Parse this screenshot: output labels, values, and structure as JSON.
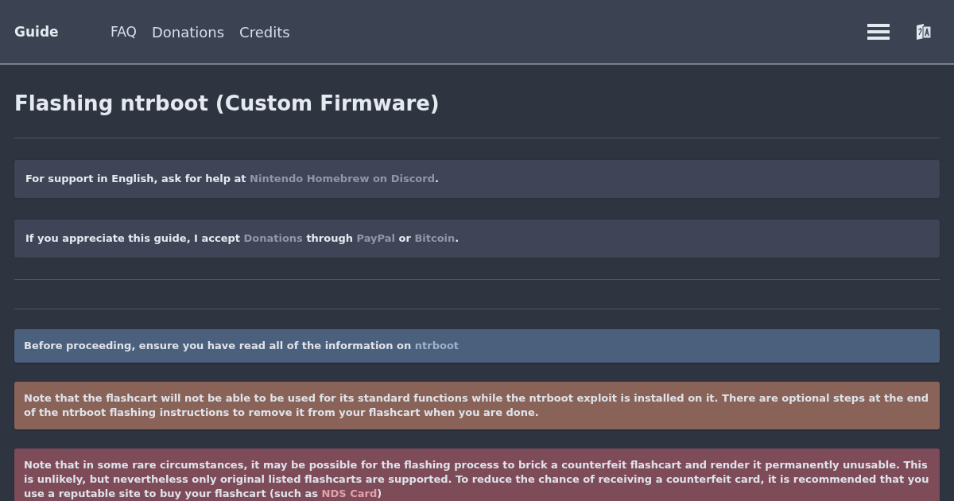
{
  "header": {
    "brand": "Guide",
    "nav": [
      {
        "label": "FAQ"
      },
      {
        "label": "Donations"
      },
      {
        "label": "Credits"
      }
    ]
  },
  "title": "Flashing ntrboot (Custom Firmware)",
  "notices": [
    {
      "segments": [
        {
          "text": "For support in English, ask for help at "
        },
        {
          "link": "Nintendo Homebrew on Discord"
        },
        {
          "text": "."
        }
      ]
    },
    {
      "segments": [
        {
          "text": "If you appreciate this guide, I accept "
        },
        {
          "link": "Donations"
        },
        {
          "text": " through "
        },
        {
          "link": "PayPal"
        },
        {
          "text": " or "
        },
        {
          "link": "Bitcoin"
        },
        {
          "text": "."
        }
      ]
    }
  ],
  "callouts": [
    {
      "kind": "info",
      "segments": [
        {
          "text": "Before proceeding, ensure you have read all of the information on "
        },
        {
          "link": "ntrboot"
        }
      ]
    },
    {
      "kind": "warning",
      "segments": [
        {
          "text": "Note that the flashcart will not be able to be used for its standard functions while the ntrboot exploit is installed on it. There are optional steps at the end of the ntrboot flashing instructions to remove it from your flashcart when you are done."
        }
      ]
    },
    {
      "kind": "danger",
      "segments": [
        {
          "text": "Note that in some rare circumstances, it may be possible for the flashing process to brick a counterfeit flashcart and render it permanently unusable. This is unlikely, but nevertheless only original listed flashcarts are supported. To reduce the chance of receiving a counterfeit card, it is recommended that you use a reputable site to buy your flashcart (such as "
        },
        {
          "link": "NDS Card"
        },
        {
          "text": ")"
        }
      ]
    }
  ]
}
